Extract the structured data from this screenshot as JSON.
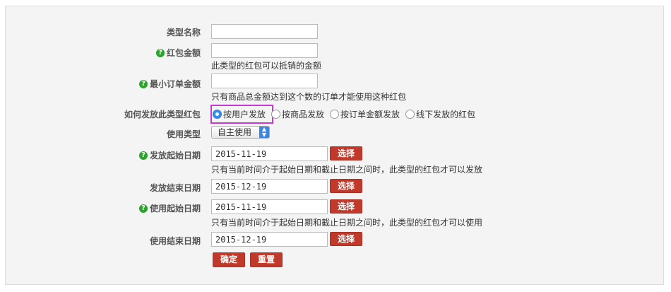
{
  "form": {
    "type_name": {
      "label": "类型名称",
      "value": ""
    },
    "amount": {
      "label": "红包金额",
      "value": "",
      "hint": "此类型的红包可以抵销的金额"
    },
    "min_order": {
      "label": "最小订单金额",
      "value": "",
      "hint": "只有商品总金额达到这个数的订单才能使用这种红包"
    },
    "send_method": {
      "label": "如何发放此类型红包",
      "options": [
        "按用户发放",
        "按商品发放",
        "按订单金额发放",
        "线下发放的红包"
      ],
      "selected": "按用户发放"
    },
    "use_type": {
      "label": "使用类型",
      "value": "自主使用"
    },
    "send_start": {
      "label": "发放起始日期",
      "value": "2015-11-19",
      "hint": "只有当前时间介于起始日期和截止日期之间时，此类型的红包才可以发放"
    },
    "send_end": {
      "label": "发放结束日期",
      "value": "2015-12-19"
    },
    "use_start": {
      "label": "使用起始日期",
      "value": "2015-11-19",
      "hint": "只有当前时间介于起始日期和截止日期之间时，此类型的红包才可以使用"
    },
    "use_end": {
      "label": "使用结束日期",
      "value": "2015-12-19"
    },
    "pick_label": "选择",
    "submit_label": "确定",
    "reset_label": "重置"
  },
  "icons": {
    "help": "help-icon",
    "select_arrow": "chevron-updown-icon"
  },
  "colors": {
    "button": "#c0392b",
    "help_icon": "#2aa42a",
    "highlight": "#c43bd1",
    "radio_checked": "#3a8ee6"
  }
}
